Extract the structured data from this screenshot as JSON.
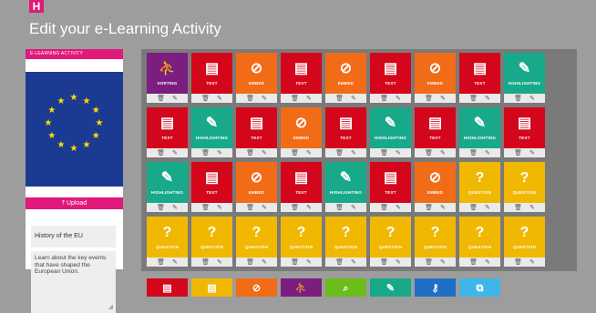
{
  "header": {
    "logo_text": "H",
    "title": "Edit your e-Learning Activity"
  },
  "activity": {
    "panel_label": "E-LEARNING ACTIVITY",
    "upload_label": "Upload",
    "upload_icon": "upload-icon",
    "title_value": "History of the EU",
    "description_value": "Learn about the key events that have shaped the European Union."
  },
  "colors": {
    "SORTING": "#7b1e80",
    "TEXT": "#d4061b",
    "EMBED": "#f26b16",
    "HIGHLIGHTING": "#18a98a",
    "QUESTION": "#f0b800",
    "brand": "#e0197a",
    "flag_blue": "#1b3a92",
    "flag_star": "#ffdd00"
  },
  "tiles": [
    [
      "SORTING",
      "TEXT",
      "EMBED",
      "TEXT",
      "EMBED",
      "TEXT",
      "EMBED",
      "TEXT",
      "HIGHLIGHTING"
    ],
    [
      "TEXT",
      "HIGHLIGHTING",
      "TEXT",
      "EMBED",
      "TEXT",
      "HIGHLIGHTING",
      "TEXT",
      "HIGHLIGHTING",
      "TEXT"
    ],
    [
      "HIGHLIGHTING",
      "TEXT",
      "EMBED",
      "TEXT",
      "HIGHLIGHTING",
      "TEXT",
      "EMBED",
      "QUESTION",
      "QUESTION"
    ],
    [
      "QUESTION",
      "QUESTION",
      "QUESTION",
      "QUESTION",
      "QUESTION",
      "QUESTION",
      "QUESTION",
      "QUESTION",
      "QUESTION"
    ]
  ],
  "palette": [
    {
      "color": "#d4061b",
      "icon": "document-icon"
    },
    {
      "color": "#f0b800",
      "icon": "document-icon"
    },
    {
      "color": "#f26b16",
      "icon": "link-icon"
    },
    {
      "color": "#7b1e80",
      "icon": "sorting-icon"
    },
    {
      "color": "#6cbd1a",
      "icon": "search-icon"
    },
    {
      "color": "#18a98a",
      "icon": "marker-icon"
    },
    {
      "color": "#1f6fc7",
      "icon": "key-icon"
    },
    {
      "color": "#3fb6e8",
      "icon": "flow-icon"
    }
  ]
}
